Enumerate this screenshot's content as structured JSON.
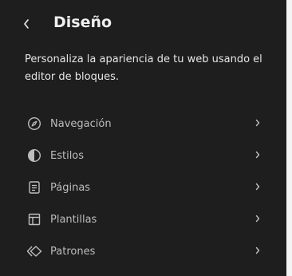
{
  "header": {
    "back_icon": "chevron-left-icon",
    "title": "Diseño"
  },
  "description": "Personaliza la apariencia de tu web usando el editor de bloques.",
  "nav": {
    "items": [
      {
        "label": "Navegación",
        "icon": "compass-icon"
      },
      {
        "label": "Estilos",
        "icon": "half-circle-icon"
      },
      {
        "label": "Páginas",
        "icon": "page-icon"
      },
      {
        "label": "Plantillas",
        "icon": "layout-icon"
      },
      {
        "label": "Patrones",
        "icon": "diamond-icon"
      }
    ]
  },
  "colors": {
    "background": "#1e1e1e",
    "text": "#f0f0f0",
    "muted_text": "#bdbdbd",
    "icon": "#bdbdbd"
  }
}
